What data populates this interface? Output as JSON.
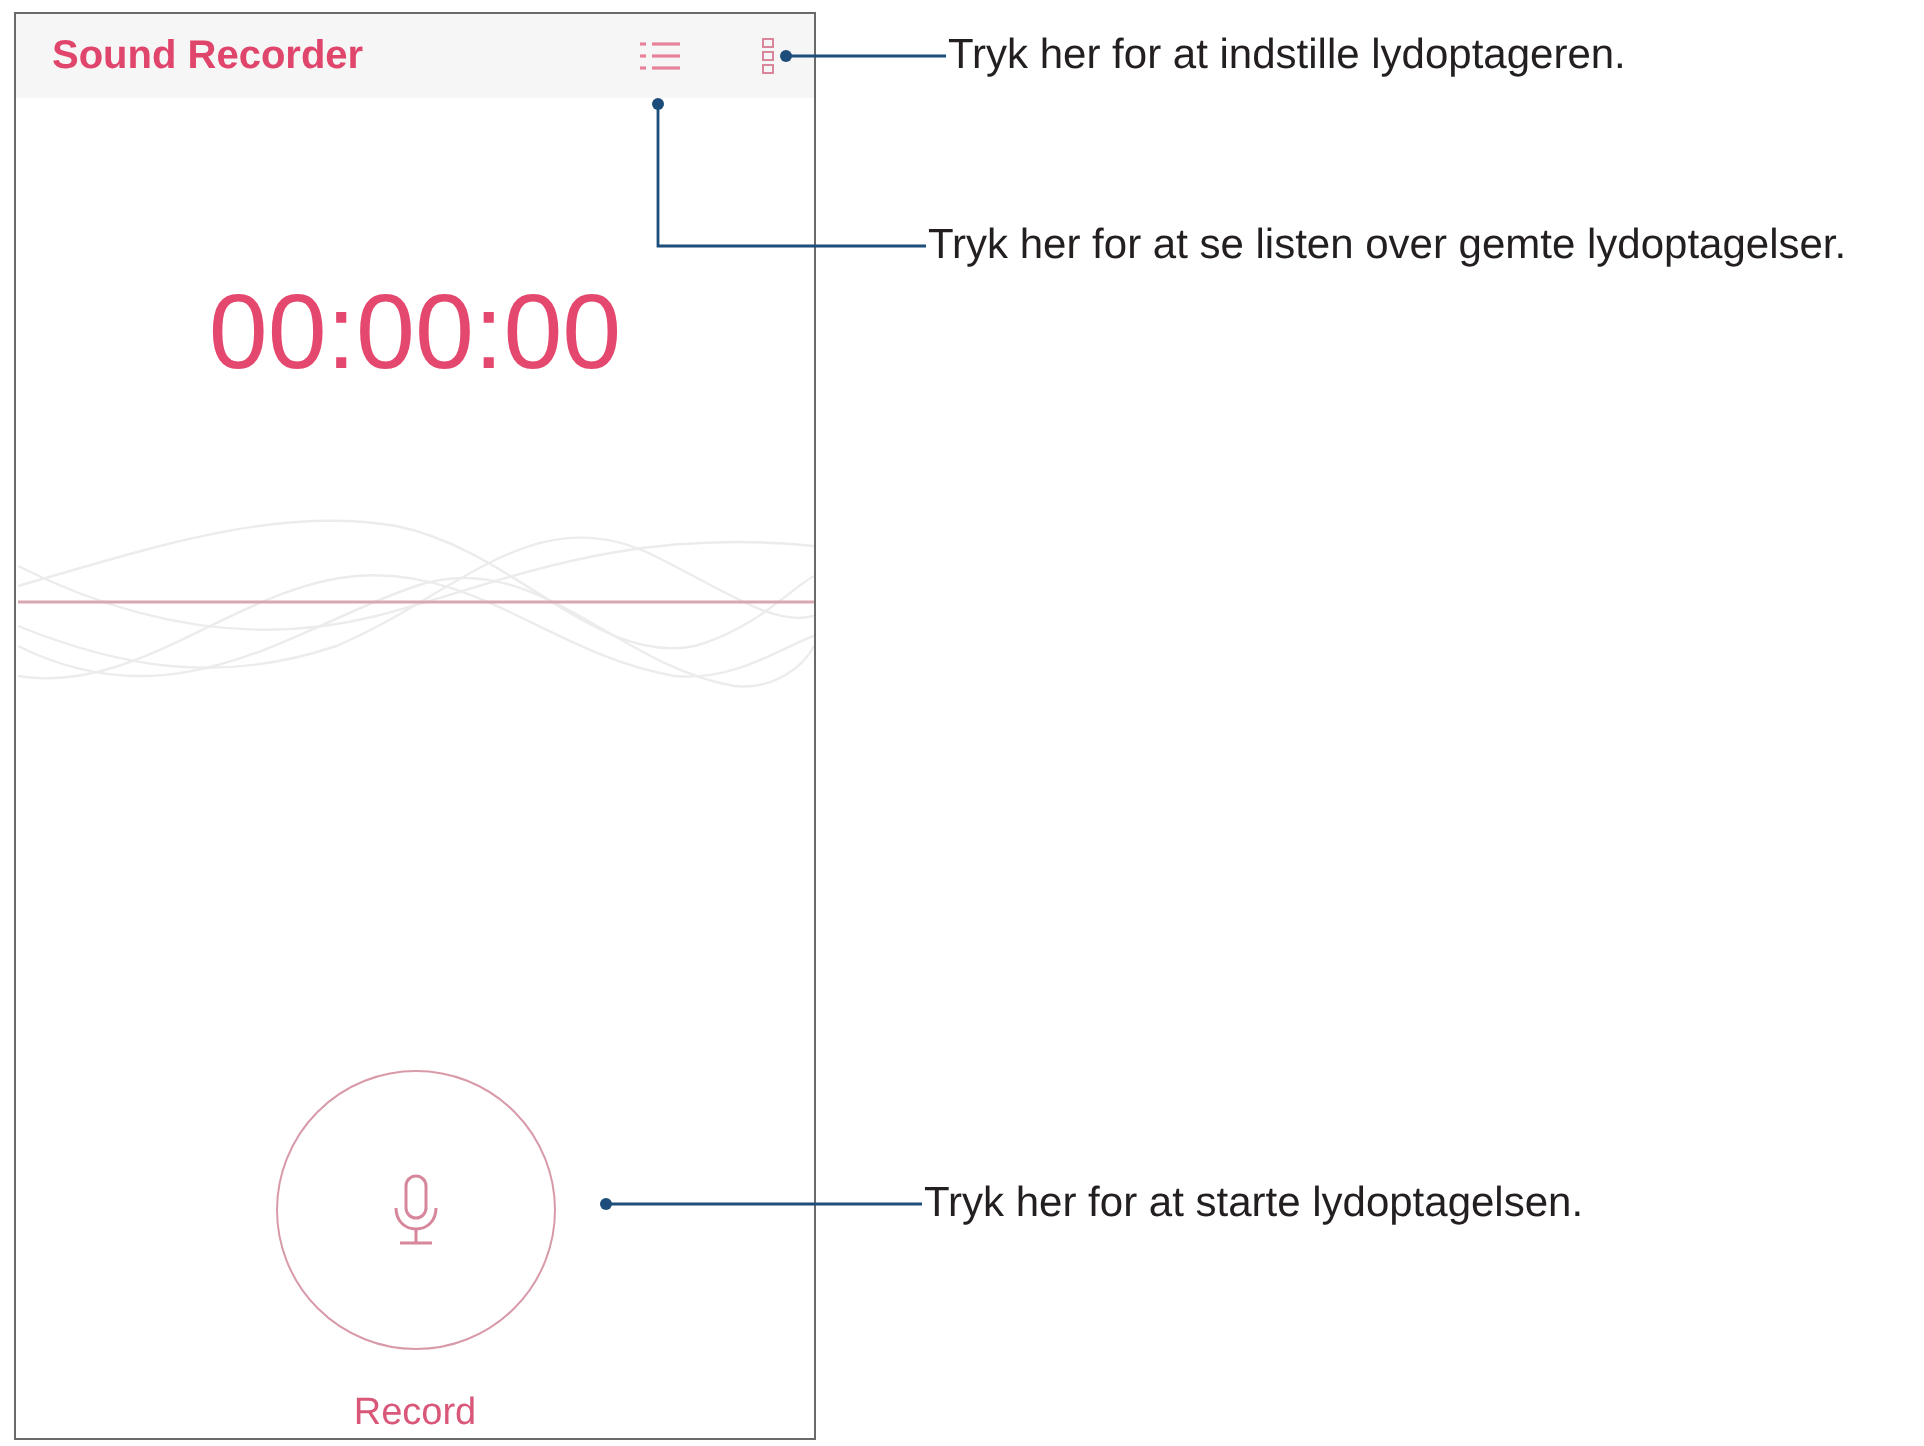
{
  "app_bar": {
    "title": "Sound Recorder"
  },
  "timer": {
    "value": "00:00:00"
  },
  "record_button": {
    "label": "Record"
  },
  "callouts": [
    {
      "kind": "straight",
      "text": "Tryk her for at indstille lydoptageren."
    },
    {
      "kind": "elbow",
      "text": "Tryk her for at se listen over gemte lydoptagelser."
    },
    {
      "kind": "straight",
      "text": "Tryk her for at starte lydoptagelsen."
    }
  ]
}
